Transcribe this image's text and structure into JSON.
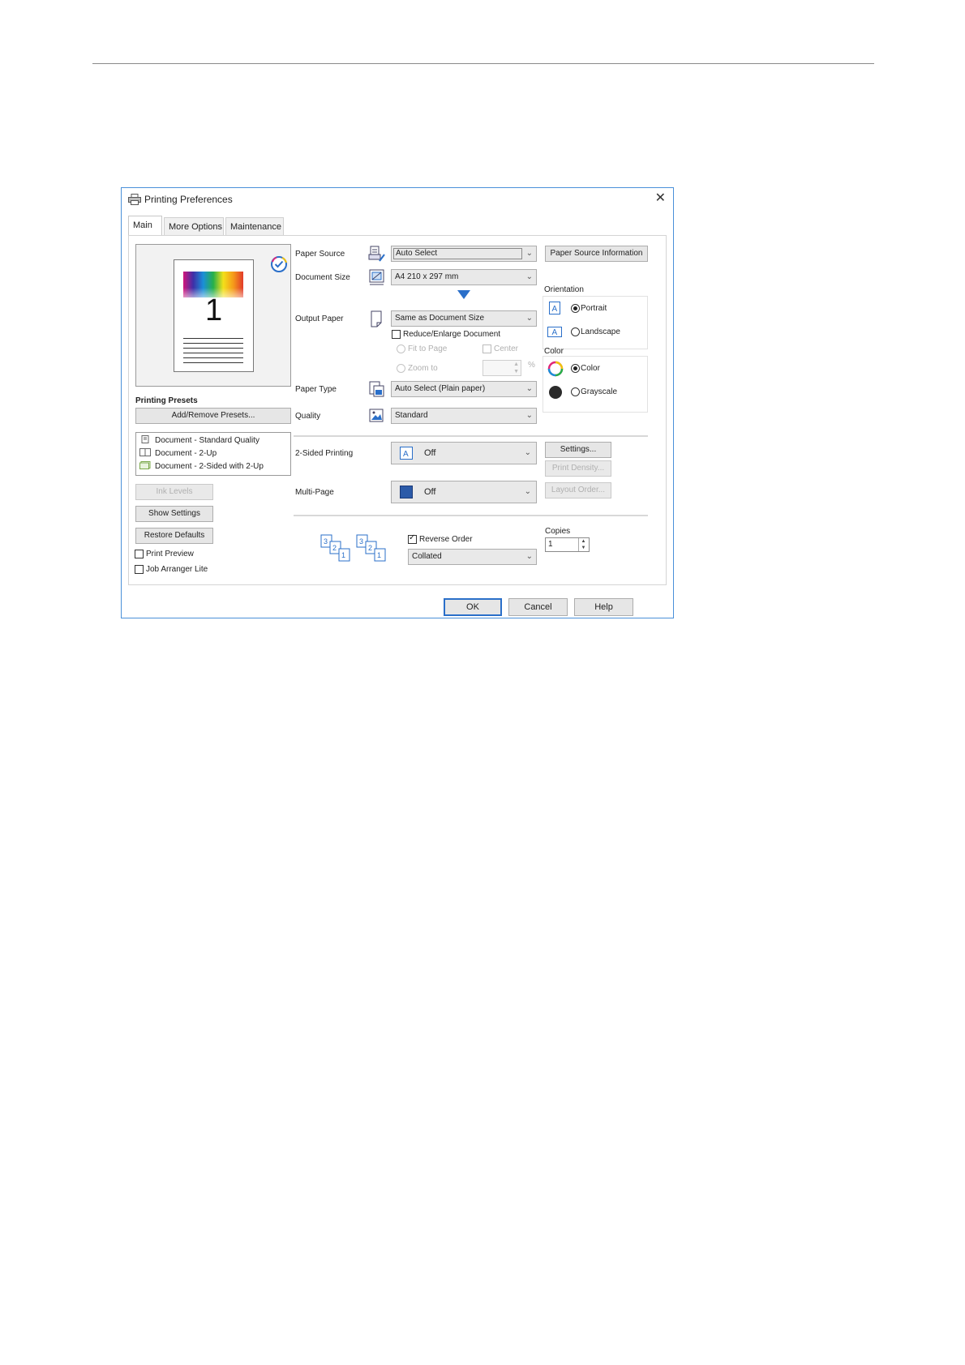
{
  "window": {
    "title": "Printing Preferences",
    "close_glyph": "✕"
  },
  "tabs": [
    {
      "label": "Main",
      "active": true
    },
    {
      "label": "More Options",
      "active": false
    },
    {
      "label": "Maintenance",
      "active": false
    }
  ],
  "preview": {
    "page_number": "1",
    "quality_icon": "check-circle-icon"
  },
  "presets": {
    "heading": "Printing Presets",
    "add_remove_button": "Add/Remove Presets...",
    "items": [
      {
        "label": "Document - Standard Quality",
        "icon": "document-icon"
      },
      {
        "label": "Document - 2-Up",
        "icon": "two-up-icon"
      },
      {
        "label": "Document - 2-Sided with 2-Up",
        "icon": "two-sided-two-up-icon"
      }
    ]
  },
  "left_buttons": {
    "ink_levels": "Ink Levels",
    "show_settings": "Show Settings",
    "restore_defaults": "Restore Defaults"
  },
  "left_checks": {
    "print_preview": "Print Preview",
    "job_arranger": "Job Arranger Lite"
  },
  "paper_source": {
    "label": "Paper Source",
    "value": "Auto Select"
  },
  "paper_source_info_button": "Paper Source Information",
  "document_size": {
    "label": "Document Size",
    "value": "A4 210 x 297 mm"
  },
  "output_paper": {
    "label": "Output Paper",
    "value": "Same as Document Size"
  },
  "reduce_enlarge": {
    "label": "Reduce/Enlarge Document",
    "checked": false,
    "fit_to_page": "Fit to Page",
    "center": "Center",
    "zoom_to": "Zoom to",
    "percent": "%"
  },
  "paper_type": {
    "label": "Paper Type",
    "value": "Auto Select (Plain paper)"
  },
  "quality": {
    "label": "Quality",
    "value": "Standard"
  },
  "orientation": {
    "heading": "Orientation",
    "portrait": "Portrait",
    "landscape": "Landscape",
    "selected": "Portrait"
  },
  "color": {
    "heading": "Color",
    "color": "Color",
    "grayscale": "Grayscale",
    "selected": "Color"
  },
  "two_sided": {
    "label": "2-Sided Printing",
    "value": "Off",
    "settings_button": "Settings...",
    "print_density_button": "Print Density..."
  },
  "multi_page": {
    "label": "Multi-Page",
    "value": "Off",
    "layout_order_button": "Layout Order..."
  },
  "reverse_order": {
    "label": "Reverse Order",
    "checked": true
  },
  "collate": {
    "value": "Collated"
  },
  "copies": {
    "label": "Copies",
    "value": "1"
  },
  "footer": {
    "ok": "OK",
    "cancel": "Cancel",
    "help": "Help"
  },
  "colors": {
    "accent": "#2a6fc9",
    "dialog_border": "#4a90d9",
    "multipage_blue": "#2b5aa8"
  }
}
